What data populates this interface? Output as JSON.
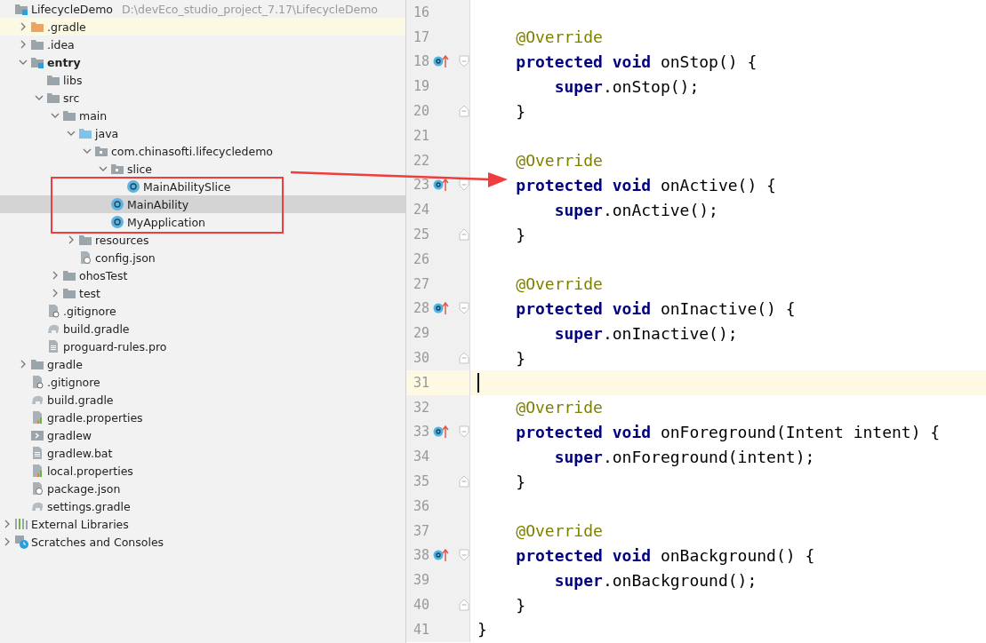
{
  "project_tree": [
    {
      "name": "LifecycleDemo",
      "kind": "module",
      "path": "D:\\devEco_studio_project_7.17\\LifecycleDemo",
      "children": [
        {
          "name": ".gradle",
          "kind": "excluded-folder",
          "expanded": false,
          "highlighted": true
        },
        {
          "name": ".idea",
          "kind": "folder",
          "expanded": false
        },
        {
          "name": "entry",
          "kind": "module",
          "bold": true,
          "expanded": true,
          "children": [
            {
              "name": "libs",
              "kind": "folder"
            },
            {
              "name": "src",
              "kind": "folder",
              "expanded": true,
              "children": [
                {
                  "name": "main",
                  "kind": "folder",
                  "expanded": true,
                  "children": [
                    {
                      "name": "java",
                      "kind": "source-folder",
                      "expanded": true,
                      "children": [
                        {
                          "name": "com.chinasofti.lifecycledemo",
                          "kind": "package",
                          "expanded": true,
                          "children": [
                            {
                              "name": "slice",
                              "kind": "package",
                              "expanded": true,
                              "children": [
                                {
                                  "name": "MainAbilitySlice",
                                  "kind": "class",
                                  "selected": false
                                }
                              ]
                            },
                            {
                              "name": "MainAbility",
                              "kind": "class",
                              "selected": true
                            },
                            {
                              "name": "MyApplication",
                              "kind": "class",
                              "selected": false
                            }
                          ]
                        }
                      ]
                    },
                    {
                      "name": "resources",
                      "kind": "resources-folder",
                      "expanded": false
                    },
                    {
                      "name": "config.json",
                      "kind": "json-file"
                    }
                  ]
                },
                {
                  "name": "ohosTest",
                  "kind": "folder",
                  "expanded": false
                },
                {
                  "name": "test",
                  "kind": "folder",
                  "expanded": false
                }
              ]
            },
            {
              "name": ".gitignore",
              "kind": "ignore-file"
            },
            {
              "name": "build.gradle",
              "kind": "gradle-file"
            },
            {
              "name": "proguard-rules.pro",
              "kind": "text-file"
            }
          ]
        },
        {
          "name": "gradle",
          "kind": "folder",
          "expanded": false
        },
        {
          "name": ".gitignore",
          "kind": "ignore-file"
        },
        {
          "name": "build.gradle",
          "kind": "gradle-file"
        },
        {
          "name": "gradle.properties",
          "kind": "properties-file"
        },
        {
          "name": "gradlew",
          "kind": "script-file"
        },
        {
          "name": "gradlew.bat",
          "kind": "text-file"
        },
        {
          "name": "local.properties",
          "kind": "properties-file"
        },
        {
          "name": "package.json",
          "kind": "json-file"
        },
        {
          "name": "settings.gradle",
          "kind": "gradle-file"
        }
      ]
    },
    {
      "name": "External Libraries",
      "kind": "libraries",
      "expanded": false
    },
    {
      "name": "Scratches and Consoles",
      "kind": "scratches",
      "expanded": false
    }
  ],
  "editor": {
    "lines": [
      {
        "number": "16",
        "overrides": false,
        "fold_start": false,
        "fold_end": false,
        "current": false
      },
      {
        "number": "17",
        "overrides": false,
        "fold_start": false,
        "fold_end": false,
        "current": false,
        "segments": [
          {
            "kind": "annotation",
            "text": "    @Override"
          }
        ]
      },
      {
        "number": "18",
        "overrides": true,
        "fold_start": true,
        "fold_end": false,
        "current": false,
        "segments": [
          {
            "kind": "keyword",
            "text": "    protected void "
          },
          {
            "kind": "plain",
            "text": "onStop() {"
          }
        ]
      },
      {
        "number": "19",
        "overrides": false,
        "fold_start": false,
        "fold_end": false,
        "current": false,
        "segments": [
          {
            "kind": "keyword",
            "text": "        super"
          },
          {
            "kind": "plain",
            "text": ".onStop();"
          }
        ]
      },
      {
        "number": "20",
        "overrides": false,
        "fold_start": false,
        "fold_end": true,
        "current": false,
        "segments": [
          {
            "kind": "plain",
            "text": "    }"
          }
        ]
      },
      {
        "number": "21",
        "overrides": false,
        "fold_start": false,
        "fold_end": false,
        "current": false
      },
      {
        "number": "22",
        "overrides": false,
        "fold_start": false,
        "fold_end": false,
        "current": false,
        "segments": [
          {
            "kind": "annotation",
            "text": "    @Override"
          }
        ]
      },
      {
        "number": "23",
        "overrides": true,
        "fold_start": true,
        "fold_end": false,
        "current": false,
        "segments": [
          {
            "kind": "keyword",
            "text": "    protected void "
          },
          {
            "kind": "plain",
            "text": "onActive() {"
          }
        ]
      },
      {
        "number": "24",
        "overrides": false,
        "fold_start": false,
        "fold_end": false,
        "current": false,
        "segments": [
          {
            "kind": "keyword",
            "text": "        super"
          },
          {
            "kind": "plain",
            "text": ".onActive();"
          }
        ]
      },
      {
        "number": "25",
        "overrides": false,
        "fold_start": false,
        "fold_end": true,
        "current": false,
        "segments": [
          {
            "kind": "plain",
            "text": "    }"
          }
        ]
      },
      {
        "number": "26",
        "overrides": false,
        "fold_start": false,
        "fold_end": false,
        "current": false
      },
      {
        "number": "27",
        "overrides": false,
        "fold_start": false,
        "fold_end": false,
        "current": false,
        "segments": [
          {
            "kind": "annotation",
            "text": "    @Override"
          }
        ]
      },
      {
        "number": "28",
        "overrides": true,
        "fold_start": true,
        "fold_end": false,
        "current": false,
        "segments": [
          {
            "kind": "keyword",
            "text": "    protected void "
          },
          {
            "kind": "plain",
            "text": "onInactive() {"
          }
        ]
      },
      {
        "number": "29",
        "overrides": false,
        "fold_start": false,
        "fold_end": false,
        "current": false,
        "segments": [
          {
            "kind": "keyword",
            "text": "        super"
          },
          {
            "kind": "plain",
            "text": ".onInactive();"
          }
        ]
      },
      {
        "number": "30",
        "overrides": false,
        "fold_start": false,
        "fold_end": true,
        "current": false,
        "segments": [
          {
            "kind": "plain",
            "text": "    }"
          }
        ]
      },
      {
        "number": "31",
        "overrides": false,
        "fold_start": false,
        "fold_end": false,
        "current": true
      },
      {
        "number": "32",
        "overrides": false,
        "fold_start": false,
        "fold_end": false,
        "current": false,
        "segments": [
          {
            "kind": "annotation",
            "text": "    @Override"
          }
        ]
      },
      {
        "number": "33",
        "overrides": true,
        "fold_start": true,
        "fold_end": false,
        "current": false,
        "segments": [
          {
            "kind": "keyword",
            "text": "    protected void "
          },
          {
            "kind": "plain",
            "text": "onForeground(Intent intent) {"
          }
        ]
      },
      {
        "number": "34",
        "overrides": false,
        "fold_start": false,
        "fold_end": false,
        "current": false,
        "segments": [
          {
            "kind": "keyword",
            "text": "        super"
          },
          {
            "kind": "plain",
            "text": ".onForeground(intent);"
          }
        ]
      },
      {
        "number": "35",
        "overrides": false,
        "fold_start": false,
        "fold_end": true,
        "current": false,
        "segments": [
          {
            "kind": "plain",
            "text": "    }"
          }
        ]
      },
      {
        "number": "36",
        "overrides": false,
        "fold_start": false,
        "fold_end": false,
        "current": false
      },
      {
        "number": "37",
        "overrides": false,
        "fold_start": false,
        "fold_end": false,
        "current": false,
        "segments": [
          {
            "kind": "annotation",
            "text": "    @Override"
          }
        ]
      },
      {
        "number": "38",
        "overrides": true,
        "fold_start": true,
        "fold_end": false,
        "current": false,
        "segments": [
          {
            "kind": "keyword",
            "text": "    protected void "
          },
          {
            "kind": "plain",
            "text": "onBackground() {"
          }
        ]
      },
      {
        "number": "39",
        "overrides": false,
        "fold_start": false,
        "fold_end": false,
        "current": false,
        "segments": [
          {
            "kind": "keyword",
            "text": "        super"
          },
          {
            "kind": "plain",
            "text": ".onBackground();"
          }
        ]
      },
      {
        "number": "40",
        "overrides": false,
        "fold_start": false,
        "fold_end": true,
        "current": false,
        "segments": [
          {
            "kind": "plain",
            "text": "    }"
          }
        ]
      },
      {
        "number": "41",
        "overrides": false,
        "fold_start": false,
        "fold_end": false,
        "current": false,
        "segments": [
          {
            "kind": "plain",
            "text": "}"
          }
        ]
      }
    ]
  }
}
